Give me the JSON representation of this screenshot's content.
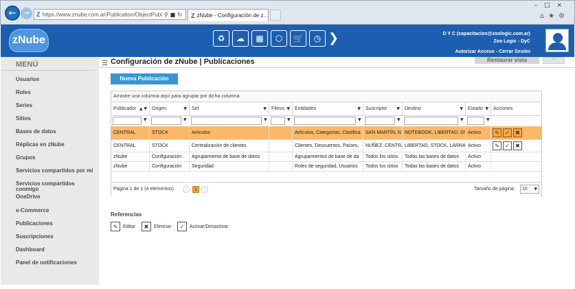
{
  "browser": {
    "address": "https://www.znube.com.ar/Publication/ObjectPubl",
    "tab_title": "zNube - Configuración de z...",
    "logo_letter": "Z"
  },
  "header": {
    "logo": "zNube",
    "user_line1": "D Y C (capacitacion@zoologic.com.ar)",
    "user_line2": "Zoo Logic - DyC",
    "link_authorize": "Autorizar Acceso",
    "separator": "-",
    "link_logout": "Cerrar Sesión"
  },
  "sidebar": {
    "title": "MENÚ",
    "items": [
      "Usuarios",
      "Roles",
      "Series",
      "Sitios",
      "Bases de datos",
      "Réplicas en zNube",
      "Grupos",
      "Servicios compartidos por mi",
      "Servicios compartidos conmigo",
      "OneDrive",
      "e-Commerce",
      "Publicaciones",
      "Suscripciones",
      "Dashboard",
      "Panel de notificaciones"
    ]
  },
  "main": {
    "title": "Configuración de zNube | Publicaciones",
    "restore_label": "Restaurar vista",
    "new_button": "Nueva Publicación",
    "group_hint": "Arrastre una columna aquí para agrupar por dicha columna"
  },
  "grid": {
    "columns": [
      "Publicador",
      "Origen",
      "Set",
      "Filtros",
      "Entidades",
      "Suscriptor",
      "Destino",
      "Estado",
      "Acciones"
    ],
    "rows": [
      [
        "CENTRAL",
        "STOCK",
        "Artículos",
        "",
        "Artículos, Categorías, Clasifica",
        "SAN MARTÍN, N",
        "NOTEBOOK, LIBERTAD, GU",
        "Activo"
      ],
      [
        "CENTRAL",
        "STOCK",
        "Centralización de clientes",
        "",
        "Clientes, Descuentos, Países,",
        "NUÑEZ, CENTRA",
        "LIBERTAD, STOCK, LARRA",
        "Activo"
      ],
      [
        "zNube",
        "Configuración",
        "Agrupamiento de base de datos",
        "",
        "Agrupamientos de base de da",
        "Todos los sitios",
        "Todas las bases de datos",
        "Activo"
      ],
      [
        "zNube",
        "Configuración",
        "Seguridad",
        "",
        "Roles de seguridad, Usuarios",
        "Todos los sitios",
        "Todas las bases de datos",
        "Activo"
      ]
    ],
    "pager_info": "Página 1 de 1 (4 elementos)",
    "current_page": "1",
    "page_size_label": "Tamaño de página:",
    "page_size": "10"
  },
  "refs": {
    "title": "Referencias",
    "edit": "Editar",
    "delete": "Eliminar",
    "toggle": "Activar/Desactivar"
  },
  "colors": {
    "brand": "#1c5fb0",
    "accent": "#3497d6",
    "selected_row": "#fbb869"
  }
}
